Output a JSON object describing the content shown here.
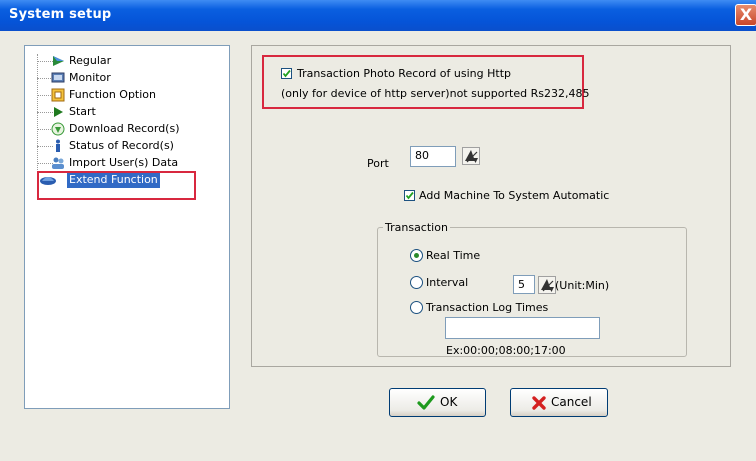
{
  "window": {
    "title": "System setup",
    "close_glyph": "X"
  },
  "tree": {
    "items": [
      {
        "label": "Regular",
        "icon": "arrow-right-icon"
      },
      {
        "label": "Monitor",
        "icon": "monitor-icon"
      },
      {
        "label": "Function Option",
        "icon": "function-option-icon"
      },
      {
        "label": "Start",
        "icon": "play-icon"
      },
      {
        "label": "Download Record(s)",
        "icon": "download-icon"
      },
      {
        "label": "Status of Record(s)",
        "icon": "info-icon"
      },
      {
        "label": "Import User(s) Data",
        "icon": "users-icon"
      },
      {
        "label": "Extend Function",
        "icon": "extend-function-icon",
        "selected": true
      }
    ]
  },
  "http": {
    "checkbox_label": "Transaction Photo Record of using Http",
    "checked": true,
    "note": "(only for device of http server)not supported Rs232,485"
  },
  "port": {
    "label": "Port",
    "value": "80"
  },
  "add_machine": {
    "label": "Add Machine To System Automatic",
    "checked": true
  },
  "transaction": {
    "legend": "Transaction",
    "real_time_label": "Real Time",
    "interval_label": "Interval",
    "interval_value": "5",
    "interval_unit": "(Unit:Min)",
    "log_times_label": "Transaction Log Times",
    "log_times_value": "",
    "log_times_example": "Ex:00:00;08:00;17:00",
    "selected": "real_time"
  },
  "buttons": {
    "ok_label": "OK",
    "cancel_label": "Cancel"
  },
  "colors": {
    "title_bar": "#0554d8",
    "highlight_box": "#d8283f",
    "selection": "#316ac5"
  }
}
